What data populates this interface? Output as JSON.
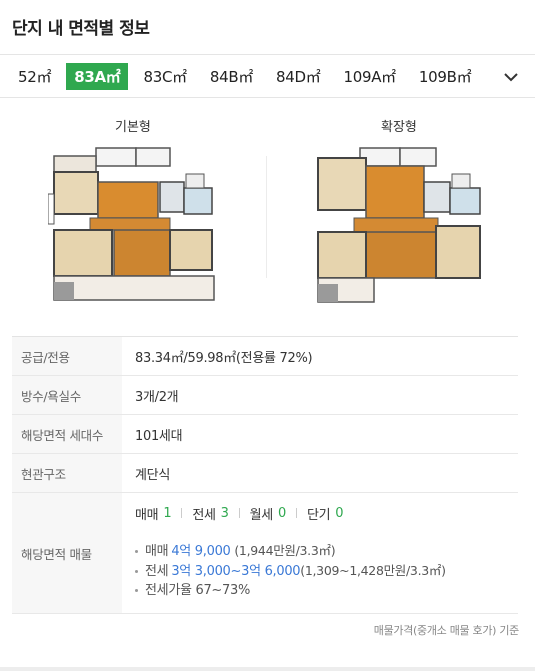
{
  "header": {
    "title": "단지 내 면적별 정보"
  },
  "tabs": [
    {
      "label": "52㎡"
    },
    {
      "label": "83A㎡"
    },
    {
      "label": "83C㎡"
    },
    {
      "label": "84B㎡"
    },
    {
      "label": "84D㎡"
    },
    {
      "label": "109A㎡"
    },
    {
      "label": "109B㎡"
    }
  ],
  "active_tab": "83A㎡",
  "floorplans": {
    "basic": {
      "title": "기본형"
    },
    "extended": {
      "title": "확장형"
    }
  },
  "info": {
    "supply": {
      "label": "공급/전용",
      "value": "83.34㎡/59.98㎡(전용률 72%)"
    },
    "rooms": {
      "label": "방수/욕실수",
      "value": "3개/2개"
    },
    "households": {
      "label": "해당면적 세대수",
      "value": "101세대"
    },
    "entrance": {
      "label": "현관구조",
      "value": "계단식"
    },
    "listings": {
      "label": "해당면적 매물",
      "counts": [
        {
          "label": "매매",
          "value": "1"
        },
        {
          "label": "전세",
          "value": "3"
        },
        {
          "label": "월세",
          "value": "0"
        },
        {
          "label": "단기",
          "value": "0"
        }
      ],
      "details": [
        {
          "label": "매매",
          "price": "4억 9,000",
          "per_area": "(1,944만원/3.3㎡)"
        },
        {
          "label": "전세",
          "price": "3억 3,000~3억 6,000",
          "per_area": "(1,309~1,428만원/3.3㎡)"
        },
        {
          "label": "전세가율 67~73%"
        }
      ]
    }
  },
  "footnote": "매물가격(중개소 매물 호가) 기준",
  "colors": {
    "accent_green": "#2fa84f",
    "price_blue": "#3b79d6"
  }
}
